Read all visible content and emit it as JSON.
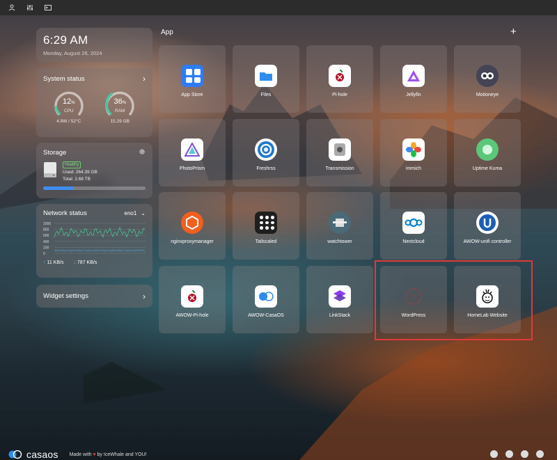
{
  "topbar": {
    "icons": [
      "user-icon",
      "sliders-icon",
      "terminal-icon"
    ]
  },
  "clock": {
    "time": "6:29 AM",
    "date": "Monday, August 26, 2024"
  },
  "system_status": {
    "title": "System status",
    "cpu": {
      "percent": "12",
      "unit": "%",
      "label": "CPU",
      "sub": "4.9W / 52°C",
      "value": 0.12
    },
    "ram": {
      "percent": "36",
      "unit": "%",
      "label": "RAM",
      "sub": "15.29 GB",
      "value": 0.36
    },
    "accent_color": "#4fc3a1"
  },
  "storage": {
    "title": "Storage",
    "badge": "Healthy",
    "used": "Used: 264.39 GB",
    "total": "Total: 2.68 TB",
    "usage_fraction": 0.3
  },
  "network": {
    "title": "Network status",
    "interface": "eno1",
    "y_ticks": [
      "1000",
      "800",
      "600",
      "400",
      "200",
      "0"
    ],
    "upload": "11 KB/s",
    "download": "787 KB/s"
  },
  "widget_settings": {
    "label": "Widget settings"
  },
  "apps": {
    "title": "App",
    "add_icon": "plus-icon",
    "items": [
      {
        "label": "App Store",
        "icon": "app-store-icon"
      },
      {
        "label": "Files",
        "icon": "folder-icon"
      },
      {
        "label": "Pi-hole",
        "icon": "pihole-icon"
      },
      {
        "label": "Jellyfin",
        "icon": "jellyfin-icon"
      },
      {
        "label": "Motioneye",
        "icon": "motioneye-icon"
      },
      {
        "label": "PhotoPrism",
        "icon": "photoprism-icon"
      },
      {
        "label": "Freshrss",
        "icon": "freshrss-icon"
      },
      {
        "label": "Transmission",
        "icon": "transmission-icon"
      },
      {
        "label": "immich",
        "icon": "immich-icon"
      },
      {
        "label": "Uptime Kuma",
        "icon": "uptime-kuma-icon"
      },
      {
        "label": "nginxproxymanager",
        "icon": "nginx-proxy-manager-icon"
      },
      {
        "label": "Tailscaled",
        "icon": "tailscale-icon"
      },
      {
        "label": "watchtower",
        "icon": "watchtower-icon"
      },
      {
        "label": "Nextcloud",
        "icon": "nextcloud-icon"
      },
      {
        "label": "AWOW-unifi controller",
        "icon": "unifi-icon"
      },
      {
        "label": "AWOW-Pi-hole",
        "icon": "pihole-icon"
      },
      {
        "label": "AWOW-CasaOS",
        "icon": "casaos-icon"
      },
      {
        "label": "LinkStack",
        "icon": "linkstack-icon"
      },
      {
        "label": "WordPress",
        "icon": "wordpress-icon"
      },
      {
        "label": "HomeLab Website",
        "icon": "homelab-icon"
      }
    ]
  },
  "footer": {
    "logo": "casaos",
    "made_prefix": "Made with",
    "made_suffix": "by IceWhale and YOU!",
    "social_icons": [
      "discord-icon",
      "mastodon-icon",
      "github-icon",
      "feedback-icon"
    ]
  }
}
